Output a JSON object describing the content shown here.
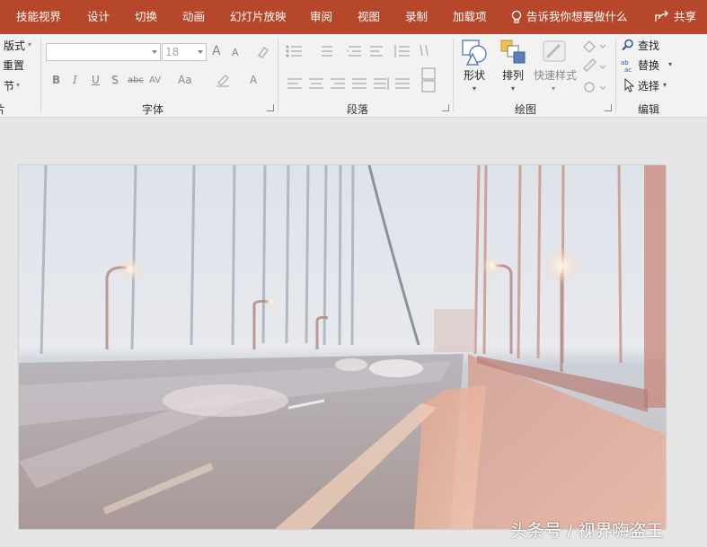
{
  "tabs": {
    "items": [
      "技能视界",
      "设计",
      "切换",
      "动画",
      "幻灯片放映",
      "审阅",
      "视图",
      "录制",
      "加载项"
    ],
    "tell_me": "告诉我你想要做什么",
    "share": "共享"
  },
  "ribbon": {
    "slides": {
      "layout": "版式",
      "reset": "重置",
      "section": "节",
      "group_label_partial": "片"
    },
    "font": {
      "font_name": "",
      "font_size": "18",
      "grow_glyph": "A",
      "shrink_glyph": "A",
      "bold": "B",
      "italic": "I",
      "underline": "U",
      "shadow": "S",
      "strike": "abc",
      "spacing": "AV",
      "case": "Aa",
      "color": "A",
      "group_label": "字体"
    },
    "paragraph": {
      "group_label": "段落"
    },
    "drawing": {
      "shapes": "形状",
      "arrange": "排列",
      "quick_styles": "快速样式",
      "group_label": "绘图"
    },
    "editing": {
      "find": "查找",
      "replace": "替换",
      "select": "选择",
      "group_label": "编辑"
    }
  },
  "watermark": "头条号 / 视界嗨盗王",
  "colors": {
    "accent": "#b7472a",
    "ribbon_bg": "#f3f2f1",
    "workspace_bg": "#e6e6e6"
  },
  "icons": [
    "lightbulb-icon",
    "share-icon",
    "shapes-icon",
    "arrange-icon",
    "quick-styles-icon",
    "find-icon",
    "replace-icon",
    "select-icon"
  ]
}
